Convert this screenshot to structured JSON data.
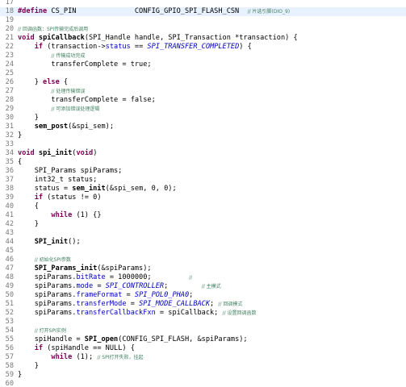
{
  "editor": {
    "lines": [
      {
        "n": "17",
        "tokens": []
      },
      {
        "n": "18",
        "current": true,
        "tokens": [
          {
            "t": "#define",
            "c": "kw"
          },
          {
            "t": " CS_PIN              CONFIG_GPIO_SPI_FLASH_CSN  "
          },
          {
            "t": "// 片选引脚(DIO_9)",
            "c": "cm"
          }
        ]
      },
      {
        "n": "19",
        "tokens": []
      },
      {
        "n": "20",
        "tokens": [
          {
            "t": "// 回调函数：SPI传输完成后调用",
            "c": "cm"
          }
        ]
      },
      {
        "n": "21",
        "tokens": [
          {
            "t": "void",
            "c": "kw"
          },
          {
            "t": " "
          },
          {
            "t": "spiCallback",
            "c": "fn"
          },
          {
            "t": "(SPI_Handle handle, SPI_Transaction *transaction) {"
          }
        ]
      },
      {
        "n": "22",
        "tokens": [
          {
            "t": "    "
          },
          {
            "t": "if",
            "c": "kw"
          },
          {
            "t": " (transaction->"
          },
          {
            "t": "status",
            "c": "fld"
          },
          {
            "t": " == "
          },
          {
            "t": "SPI_TRANSFER_COMPLETED",
            "c": "mac"
          },
          {
            "t": ") {"
          }
        ]
      },
      {
        "n": "23",
        "tokens": [
          {
            "t": "        "
          },
          {
            "t": "// 传输成功完成",
            "c": "cm"
          }
        ]
      },
      {
        "n": "24",
        "tokens": [
          {
            "t": "        transferComplete = true;"
          }
        ]
      },
      {
        "n": "25",
        "tokens": []
      },
      {
        "n": "26",
        "tokens": [
          {
            "t": "    } "
          },
          {
            "t": "else",
            "c": "kw"
          },
          {
            "t": " {"
          }
        ]
      },
      {
        "n": "27",
        "tokens": [
          {
            "t": "        "
          },
          {
            "t": "// 处理传输错误",
            "c": "cm"
          }
        ]
      },
      {
        "n": "28",
        "tokens": [
          {
            "t": "        transferComplete = false;"
          }
        ]
      },
      {
        "n": "29",
        "tokens": [
          {
            "t": "        "
          },
          {
            "t": "// 可添加错误处理逻辑",
            "c": "cm"
          }
        ]
      },
      {
        "n": "30",
        "tokens": [
          {
            "t": "    }"
          }
        ]
      },
      {
        "n": "31",
        "tokens": [
          {
            "t": "    "
          },
          {
            "t": "sem_post",
            "c": "fn"
          },
          {
            "t": "(&spi_sem);"
          }
        ]
      },
      {
        "n": "32",
        "tokens": [
          {
            "t": "}"
          }
        ]
      },
      {
        "n": "33",
        "tokens": []
      },
      {
        "n": "34",
        "tokens": [
          {
            "t": "void",
            "c": "kw"
          },
          {
            "t": " "
          },
          {
            "t": "spi_init",
            "c": "fn"
          },
          {
            "t": "("
          },
          {
            "t": "void",
            "c": "kw"
          },
          {
            "t": ")"
          }
        ]
      },
      {
        "n": "35",
        "tokens": [
          {
            "t": "{"
          }
        ]
      },
      {
        "n": "36",
        "tokens": [
          {
            "t": "    SPI_Params spiParams;"
          }
        ]
      },
      {
        "n": "37",
        "tokens": [
          {
            "t": "    int32_t status;"
          }
        ]
      },
      {
        "n": "38",
        "tokens": [
          {
            "t": "    status = "
          },
          {
            "t": "sem_init",
            "c": "fn"
          },
          {
            "t": "(&spi_sem, 0, 0);"
          }
        ]
      },
      {
        "n": "39",
        "tokens": [
          {
            "t": "    "
          },
          {
            "t": "if",
            "c": "kw"
          },
          {
            "t": " (status != 0)"
          }
        ]
      },
      {
        "n": "40",
        "tokens": [
          {
            "t": "    {"
          }
        ]
      },
      {
        "n": "41",
        "tokens": [
          {
            "t": "        "
          },
          {
            "t": "while",
            "c": "kw"
          },
          {
            "t": " (1) {}"
          }
        ]
      },
      {
        "n": "42",
        "tokens": [
          {
            "t": "    }"
          }
        ]
      },
      {
        "n": "43",
        "tokens": []
      },
      {
        "n": "44",
        "tokens": [
          {
            "t": "    "
          },
          {
            "t": "SPI_init",
            "c": "fn"
          },
          {
            "t": "();"
          }
        ]
      },
      {
        "n": "45",
        "tokens": []
      },
      {
        "n": "46",
        "tokens": [
          {
            "t": "    "
          },
          {
            "t": "// 初始化SPI参数",
            "c": "cm"
          }
        ]
      },
      {
        "n": "47",
        "tokens": [
          {
            "t": "    "
          },
          {
            "t": "SPI_Params_init",
            "c": "fn"
          },
          {
            "t": "(&spiParams);"
          }
        ]
      },
      {
        "n": "48",
        "tokens": [
          {
            "t": "    spiParams."
          },
          {
            "t": "bitRate",
            "c": "fld"
          },
          {
            "t": " = 1000000;         "
          },
          {
            "t": "//",
            "c": "cm"
          }
        ]
      },
      {
        "n": "49",
        "tokens": [
          {
            "t": "    spiParams."
          },
          {
            "t": "mode",
            "c": "fld"
          },
          {
            "t": " = "
          },
          {
            "t": "SPI_CONTROLLER",
            "c": "mac"
          },
          {
            "t": ";        "
          },
          {
            "t": "// 主模式",
            "c": "cm"
          }
        ]
      },
      {
        "n": "50",
        "tokens": [
          {
            "t": "    spiParams."
          },
          {
            "t": "frameFormat",
            "c": "fld"
          },
          {
            "t": " = "
          },
          {
            "t": "SPI_POL0_PHA0",
            "c": "mac"
          },
          {
            "t": ";"
          }
        ]
      },
      {
        "n": "51",
        "tokens": [
          {
            "t": "    spiParams."
          },
          {
            "t": "transferMode",
            "c": "fld"
          },
          {
            "t": " = "
          },
          {
            "t": "SPI_MODE_CALLBACK",
            "c": "mac"
          },
          {
            "t": "; "
          },
          {
            "t": "// 回调模式",
            "c": "cm"
          }
        ]
      },
      {
        "n": "52",
        "tokens": [
          {
            "t": "    spiParams."
          },
          {
            "t": "transferCallbackFxn",
            "c": "fld"
          },
          {
            "t": " = spiCallback; "
          },
          {
            "t": "// 设置回调函数",
            "c": "cm"
          }
        ]
      },
      {
        "n": "53",
        "tokens": []
      },
      {
        "n": "54",
        "tokens": [
          {
            "t": "    "
          },
          {
            "t": "// 打开SPI实例",
            "c": "cm"
          }
        ]
      },
      {
        "n": "55",
        "tokens": [
          {
            "t": "    spiHandle = "
          },
          {
            "t": "SPI_open",
            "c": "fn"
          },
          {
            "t": "(CONFIG_SPI_FLASH, &spiParams);"
          }
        ]
      },
      {
        "n": "56",
        "tokens": [
          {
            "t": "    "
          },
          {
            "t": "if",
            "c": "kw"
          },
          {
            "t": " (spiHandle == NULL) {"
          }
        ]
      },
      {
        "n": "57",
        "tokens": [
          {
            "t": "        "
          },
          {
            "t": "while",
            "c": "kw"
          },
          {
            "t": " (1); "
          },
          {
            "t": "// SPI打开失败，挂起",
            "c": "cm"
          }
        ]
      },
      {
        "n": "58",
        "tokens": [
          {
            "t": "    }"
          }
        ]
      },
      {
        "n": "59",
        "tokens": [
          {
            "t": "}"
          }
        ]
      },
      {
        "n": "60",
        "tokens": []
      }
    ]
  }
}
